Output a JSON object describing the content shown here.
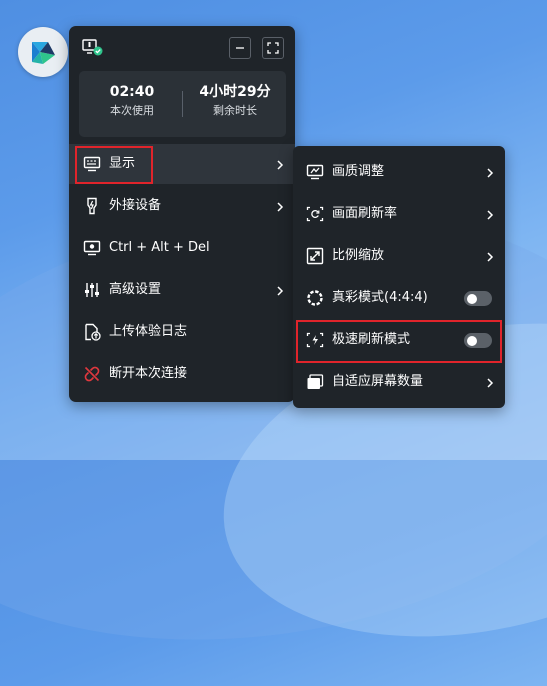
{
  "header": {
    "minimize_label": "minimize",
    "fullscreen_label": "fullscreen"
  },
  "usage": {
    "session_time": "02:40",
    "session_label": "本次使用",
    "remaining_time": "4小时29分",
    "remaining_label": "剩余时长"
  },
  "menu": {
    "items": [
      {
        "label": "显示",
        "icon": "monitor-icon",
        "has_submenu": true
      },
      {
        "label": "外接设备",
        "icon": "usb-icon",
        "has_submenu": true
      },
      {
        "label": "Ctrl + Alt + Del",
        "icon": "screen-keyboard-icon",
        "has_submenu": false
      },
      {
        "label": "高级设置",
        "icon": "sliders-icon",
        "has_submenu": true
      },
      {
        "label": "上传体验日志",
        "icon": "upload-log-icon",
        "has_submenu": false
      },
      {
        "label": "断开本次连接",
        "icon": "disconnect-icon",
        "has_submenu": false
      }
    ]
  },
  "submenu": {
    "items": [
      {
        "label": "画质调整",
        "icon": "quality-icon",
        "type": "submenu"
      },
      {
        "label": "画面刷新率",
        "icon": "refresh-rate-icon",
        "type": "submenu"
      },
      {
        "label": "比例缩放",
        "icon": "scale-icon",
        "type": "submenu"
      },
      {
        "label": "真彩模式(4:4:4)",
        "icon": "color-ring-icon",
        "type": "toggle",
        "on": false
      },
      {
        "label": "极速刷新模式",
        "icon": "fast-refresh-icon",
        "type": "toggle",
        "on": false
      },
      {
        "label": "自适应屏幕数量",
        "icon": "multi-screen-icon",
        "type": "submenu"
      }
    ]
  },
  "colors": {
    "panel_bg": "#1f2429",
    "highlight_box": "#e0242b",
    "accent_red": "#e0383e",
    "toggle_off": "#5b6168",
    "status_green": "#2fc58c"
  }
}
